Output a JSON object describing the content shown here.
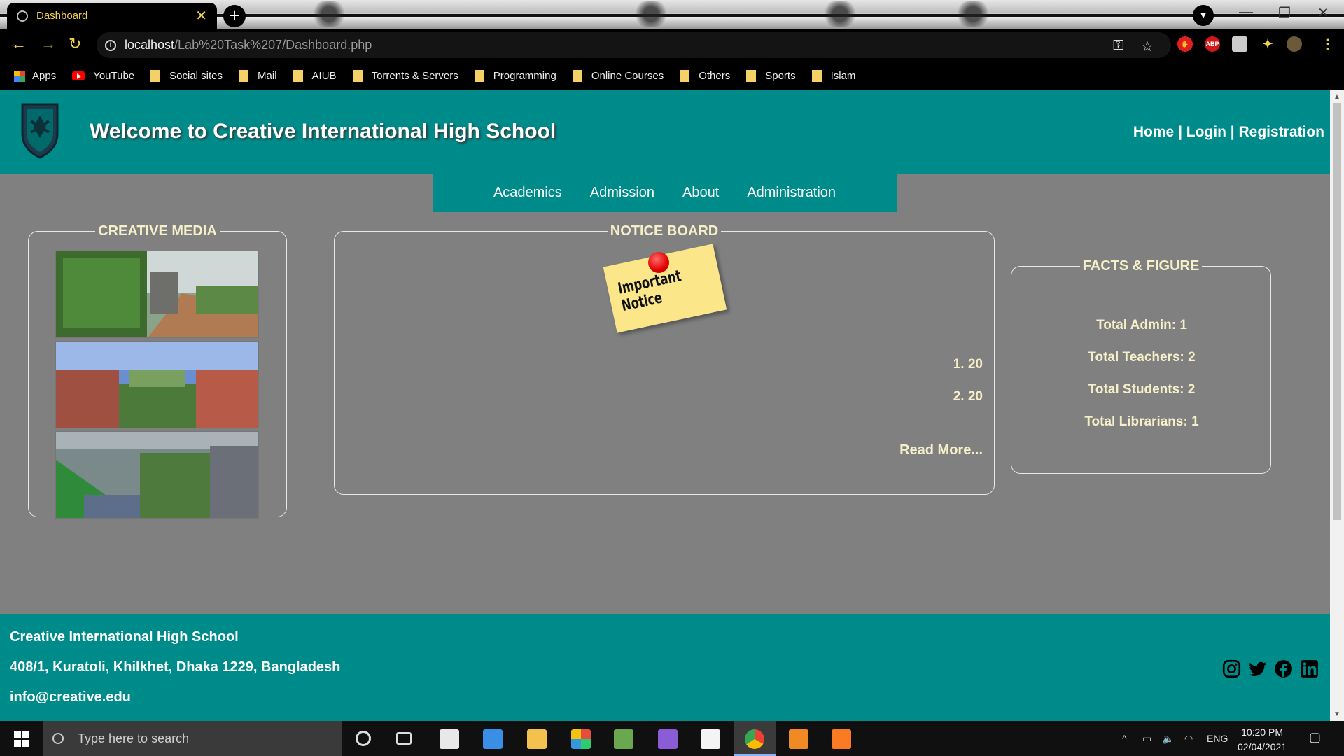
{
  "browser": {
    "tab_title": "Dashboard",
    "tab_close": "✕",
    "new_tab": "+",
    "url_host": "localhost",
    "url_path": "/Lab%20Task%207/Dashboard.php",
    "extensions": [
      "ABP"
    ],
    "bookmarks": [
      {
        "label": "Apps",
        "icon": "apps-icon"
      },
      {
        "label": "YouTube",
        "icon": "youtube-icon"
      },
      {
        "label": "Social sites",
        "icon": "folder-icon"
      },
      {
        "label": "Mail",
        "icon": "folder-icon"
      },
      {
        "label": "AIUB",
        "icon": "folder-icon"
      },
      {
        "label": "Torrents & Servers",
        "icon": "folder-icon"
      },
      {
        "label": "Programming",
        "icon": "folder-icon"
      },
      {
        "label": "Online Courses",
        "icon": "folder-icon"
      },
      {
        "label": "Others",
        "icon": "folder-icon"
      },
      {
        "label": "Sports",
        "icon": "folder-icon"
      },
      {
        "label": "Islam",
        "icon": "folder-icon"
      }
    ]
  },
  "header": {
    "welcome": "Welcome to Creative International High School",
    "links": [
      "Home",
      "Login",
      "Registration"
    ],
    "separator": " | "
  },
  "nav": [
    "Academics",
    "Admission",
    "About",
    "Administration"
  ],
  "media": {
    "title": "CREATIVE MEDIA"
  },
  "notice": {
    "title": "NOTICE BOARD",
    "sticky_text": "Important Notice",
    "items": [
      "1. 20",
      "2. 20"
    ],
    "read_more": "Read More..."
  },
  "facts": {
    "title": "FACTS & FIGURE",
    "items": [
      "Total Admin: 1",
      "Total Teachers: 2",
      "Total Students: 2",
      "Total Librarians: 1"
    ]
  },
  "footer": {
    "name": "Creative International High School",
    "address": "408/1, Kuratoli, Khilkhet, Dhaka 1229, Bangladesh",
    "email": "info@creative.edu",
    "social": [
      "instagram-icon",
      "twitter-icon",
      "facebook-icon",
      "linkedin-icon"
    ]
  },
  "taskbar": {
    "search_placeholder": "Type here to search",
    "language": "ENG",
    "time": "10:20 PM",
    "date": "02/04/2021"
  },
  "colors": {
    "teal": "#008b8b",
    "page_bg": "#808080",
    "accent_text": "#f5f0c8"
  }
}
